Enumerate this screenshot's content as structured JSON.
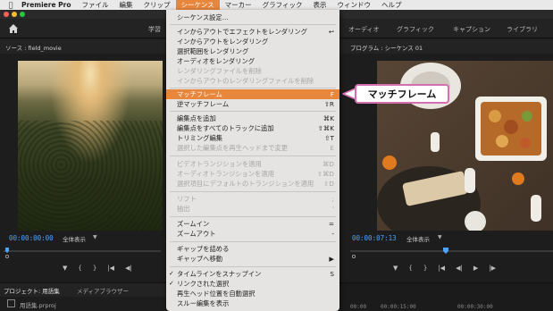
{
  "menubar": {
    "app_name": "Premiere Pro",
    "items": [
      "ファイル",
      "編集",
      "クリップ",
      "シーケンス",
      "マーカー",
      "グラフィック",
      "表示",
      "ウィンドウ",
      "ヘルプ"
    ],
    "active": "シーケンス"
  },
  "workspace": {
    "tabs": [
      "学習",
      "オーディオ",
      "グラフィック",
      "キャプション",
      "ライブラリ"
    ]
  },
  "source_panel": {
    "title": "ソース : field_movie",
    "timecode": "00:00:00:00",
    "zoom": "全体表示"
  },
  "program_panel": {
    "title": "プログラム : シーケンス 01",
    "timecode": "00:00:07:13",
    "zoom": "全体表示"
  },
  "project_panel": {
    "title": "プロジェクト: 用語集",
    "media_browser": "メディアブラウザー",
    "file": "用語集.prproj"
  },
  "timeline": {
    "ticks": [
      "00:00",
      "00:00:15:00",
      "00:00:30:00"
    ]
  },
  "menu": {
    "items": [
      {
        "label": "シーケンス設定...",
        "shortcut": "",
        "disabled": false
      },
      {
        "label": "インからアウトでエフェクトをレンダリング",
        "shortcut": "↩",
        "disabled": false
      },
      {
        "label": "インからアウトをレンダリング",
        "shortcut": "",
        "disabled": false
      },
      {
        "label": "選択範囲をレンダリング",
        "shortcut": "",
        "disabled": false
      },
      {
        "label": "オーディオをレンダリング",
        "shortcut": "",
        "disabled": false
      },
      {
        "label": "レンダリングファイルを削除",
        "shortcut": "",
        "disabled": true
      },
      {
        "label": "インからアウトのレンダリングファイルを削除",
        "shortcut": "",
        "disabled": true
      },
      {
        "label": "マッチフレーム",
        "shortcut": "F",
        "disabled": false,
        "highlighted": true
      },
      {
        "label": "逆マッチフレーム",
        "shortcut": "⇧R",
        "disabled": false
      },
      {
        "label": "編集点を追加",
        "shortcut": "⌘K",
        "disabled": false
      },
      {
        "label": "編集点をすべてのトラックに追加",
        "shortcut": "⇧⌘K",
        "disabled": false
      },
      {
        "label": "トリミング編集",
        "shortcut": "⇧T",
        "disabled": false
      },
      {
        "label": "選択した編集点を再生ヘッドまで変更",
        "shortcut": "E",
        "disabled": true
      },
      {
        "label": "ビデオトランジションを適用",
        "shortcut": "⌘D",
        "disabled": true
      },
      {
        "label": "オーディオトランジションを適用",
        "shortcut": "⇧⌘D",
        "disabled": true
      },
      {
        "label": "選択項目にデフォルトのトランジションを適用",
        "shortcut": "⇧D",
        "disabled": true
      },
      {
        "label": "リフト",
        "shortcut": ";",
        "disabled": true
      },
      {
        "label": "抽出",
        "shortcut": "'",
        "disabled": true
      },
      {
        "label": "ズームイン",
        "shortcut": "=",
        "disabled": false
      },
      {
        "label": "ズームアウト",
        "shortcut": "-",
        "disabled": false
      },
      {
        "label": "ギャップを詰める",
        "shortcut": "",
        "disabled": false
      },
      {
        "label": "ギャップへ移動",
        "shortcut": "▶",
        "disabled": false
      },
      {
        "label": "タイムラインをスナップイン",
        "shortcut": "S",
        "disabled": false,
        "checked": true
      },
      {
        "label": "リンクされた選択",
        "shortcut": "",
        "disabled": false,
        "checked": true
      },
      {
        "label": "再生ヘッド位置を自動選択",
        "shortcut": "",
        "disabled": false
      },
      {
        "label": "スルー編集を表示",
        "shortcut": "",
        "disabled": false
      }
    ]
  },
  "callout": {
    "text": "マッチフレーム"
  },
  "colors": {
    "menu_highlight": "#e8873c",
    "timecode": "#4ea3ff",
    "callout_border": "#d46fb0"
  },
  "icons": [
    "apple-icon",
    "home-icon",
    "playhead-icon",
    "marker-icon",
    "in-point-icon",
    "out-point-icon",
    "step-back-icon",
    "play-icon",
    "step-forward-icon",
    "checkmark-icon",
    "submenu-arrow-icon",
    "file-icon"
  ]
}
